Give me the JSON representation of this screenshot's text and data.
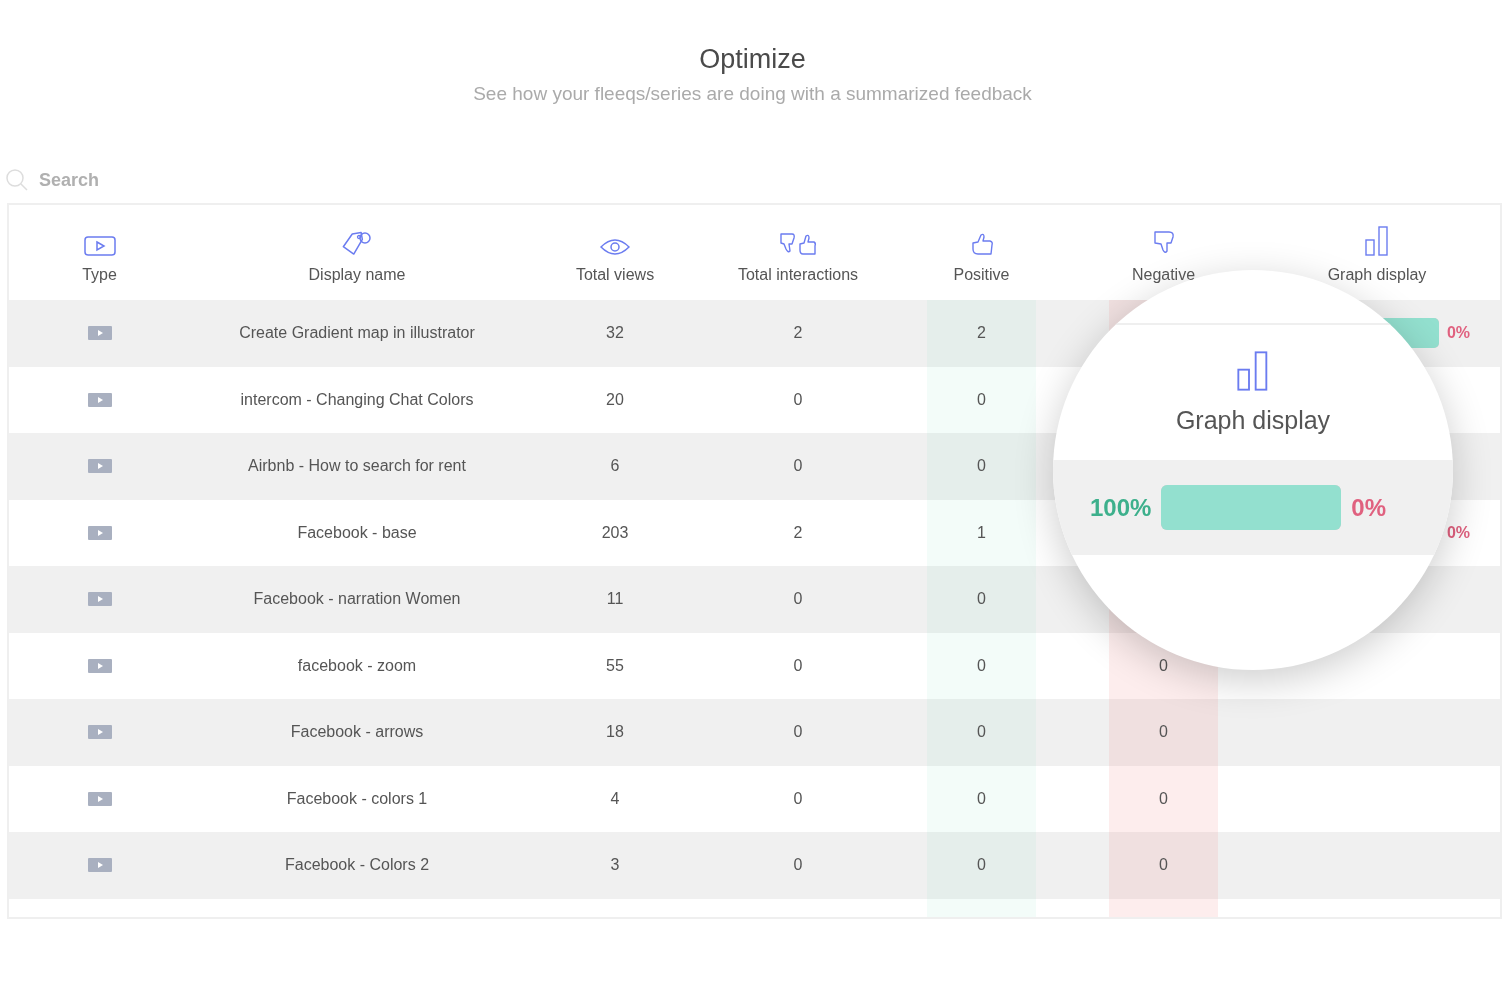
{
  "header": {
    "title": "Optimize",
    "subtitle": "See how your fleeqs/series are doing with a summarized feedback"
  },
  "search": {
    "placeholder": "Search"
  },
  "columns": [
    {
      "label": "Type",
      "kind": "video"
    },
    {
      "label": "Display name",
      "kind": "tag"
    },
    {
      "label": "Total views",
      "kind": "eye"
    },
    {
      "label": "Total interactions",
      "kind": "thumbs"
    },
    {
      "label": "Positive",
      "kind": "thumb-up"
    },
    {
      "label": "Negative",
      "kind": "thumb-down"
    },
    {
      "label": "Graph display",
      "kind": "bars"
    }
  ],
  "rows": [
    {
      "name": "Create Gradient map in illustrator",
      "views": "32",
      "interactions": "2",
      "positive": "2",
      "graph": {
        "level": 1,
        "negative": "0%"
      }
    },
    {
      "name": "intercom - Changing Chat Colors",
      "views": "20",
      "interactions": "0",
      "positive": "0"
    },
    {
      "name": "Airbnb - How to search for rent",
      "views": "6",
      "interactions": "0",
      "positive": "0"
    },
    {
      "name": "Facebook - base",
      "views": "203",
      "interactions": "2",
      "positive": "1",
      "graph": {
        "negative": "0%"
      }
    },
    {
      "name": "Facebook - narration Women",
      "views": "11",
      "interactions": "0",
      "positive": "0"
    },
    {
      "name": "facebook - zoom",
      "views": "55",
      "interactions": "0",
      "positive": "0",
      "negative": "0"
    },
    {
      "name": "Facebook - arrows",
      "views": "18",
      "interactions": "0",
      "positive": "0",
      "negative": "0"
    },
    {
      "name": "Facebook - colors 1",
      "views": "4",
      "interactions": "0",
      "positive": "0",
      "negative": "0"
    },
    {
      "name": "Facebook - Colors 2",
      "views": "3",
      "interactions": "0",
      "positive": "0",
      "negative": "0"
    }
  ],
  "magnifier": {
    "title": "Graph display",
    "positive": "100%",
    "level": 1,
    "negative": "0%"
  }
}
